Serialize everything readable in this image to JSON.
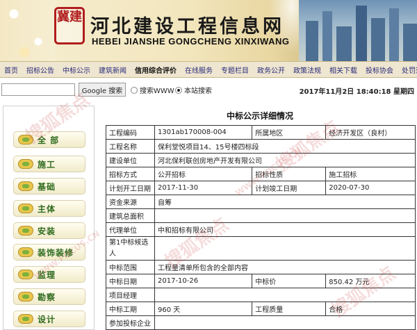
{
  "site": {
    "logo_text": "冀建",
    "title_cn": "河北建设工程信息网",
    "title_en": "HEBEI JIANSHE GONGCHENG XINXIWANG"
  },
  "nav": [
    "首页",
    "招标公告",
    "中标公示",
    "建筑新闻",
    "信用综合评价",
    "在线服务",
    "专题栏目",
    "政务公开",
    "政策法规",
    "相关下载",
    "投标协会",
    "处罚通报"
  ],
  "search": {
    "value": "",
    "button": "Google 搜索",
    "radio_web": "搜索WWW",
    "radio_site": "本站搜索",
    "selected": "site",
    "datetime": "2017年11月2日 18:40:18 星期四"
  },
  "sidebar": [
    "全 部",
    "施工",
    "基础",
    "主体",
    "安装",
    "装饰装修",
    "监理",
    "勘察",
    "设计"
  ],
  "detail": {
    "title": "中标公示详细情况",
    "rows": [
      [
        "工程编码",
        "1301ab170008-004",
        "所属地区",
        "经济开发区（良村）"
      ],
      [
        "工程名称",
        "保利堂悦项目14、15号楼四标段"
      ],
      [
        "建设单位",
        "河北保利联创房地产开发有限公司"
      ],
      [
        "招标方式",
        "公开招标",
        "招标性质",
        "施工招标"
      ],
      [
        "计划开工日期",
        "2017-11-30",
        "计划竣工日期",
        "2020-07-30"
      ],
      [
        "资金来源",
        "自筹"
      ],
      [
        "建筑总面积",
        ""
      ],
      [
        "代理单位",
        "中和招标有限公司"
      ],
      [
        "第1中标候选人",
        ""
      ],
      [
        "中标范围",
        "工程量清单所包含的全部内容"
      ],
      [
        "中标日期",
        "2017-10-26",
        "中标价",
        "850.42 万元"
      ],
      [
        "项目经理",
        ""
      ],
      [
        "中标工期",
        "960 天",
        "工程质量",
        "合格"
      ],
      [
        "参加投标企业",
        ""
      ]
    ]
  },
  "watermark": {
    "text": "搜狐焦点",
    "sub": "WWW.FOCUS.CN"
  },
  "colors": {
    "nav_bg": "#eee6d0",
    "sidebar_label": "#2f6b1f",
    "watermark": "#c83c3c"
  }
}
